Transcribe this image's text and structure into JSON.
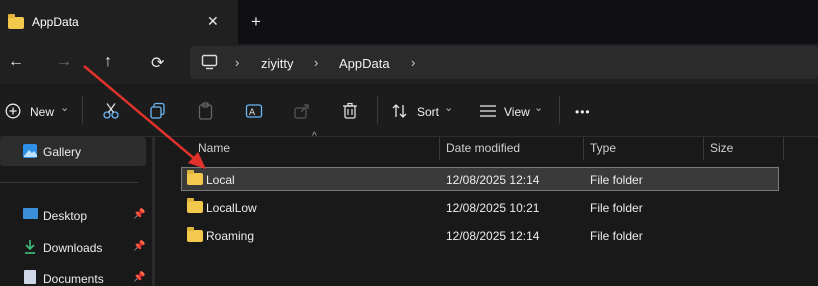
{
  "window": {
    "tab_title": "AppData",
    "close_glyph": "✕",
    "new_tab_glyph": "+"
  },
  "nav": {
    "back": "←",
    "forward": "→",
    "up": "↑",
    "refresh": "⟳"
  },
  "breadcrumb": {
    "items": [
      "ziyitty",
      "AppData"
    ],
    "separator": "›"
  },
  "toolbar": {
    "new_label": "New",
    "sort_label": "Sort",
    "view_label": "View",
    "more": "•••",
    "dropdown": "⌄"
  },
  "sidebar": {
    "items": [
      {
        "label": "Gallery",
        "icon": "gallery-icon",
        "selected": true
      },
      {
        "label": "Desktop",
        "icon": "desktop-icon",
        "pinned": true
      },
      {
        "label": "Downloads",
        "icon": "downloads-icon",
        "pinned": true
      },
      {
        "label": "Documents",
        "icon": "documents-icon",
        "pinned": true
      }
    ]
  },
  "columns": [
    "Name",
    "Date modified",
    "Type",
    "Size"
  ],
  "rows": [
    {
      "name": "Local",
      "date": "12/08/2025 12:14",
      "type": "File folder",
      "size": ""
    },
    {
      "name": "LocalLow",
      "date": "12/08/2025 10:21",
      "type": "File folder",
      "size": ""
    },
    {
      "name": "Roaming",
      "date": "12/08/2025 12:14",
      "type": "File folder",
      "size": ""
    }
  ],
  "colors": {
    "accent_arrow": "#e0322b",
    "folder": "#f2c94c",
    "selection": "#3a3a3a"
  }
}
